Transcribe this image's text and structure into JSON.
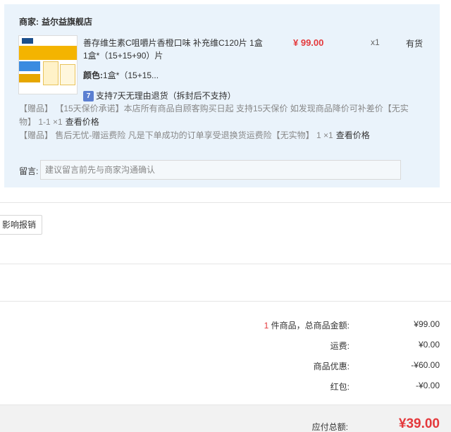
{
  "order": {
    "merchant_label": "商家:",
    "merchant_name": "益尔益旗舰店",
    "product": {
      "title": "善存维生素C咀嚼片香橙口味 补充维C120片 1盒 1盒*（15+15+90）片",
      "color_label": "颜色:",
      "color_value": "1盒*（15+15...",
      "price": "¥ 99.00",
      "quantity": "x1",
      "stock": "有货"
    },
    "return_policy": {
      "badge": "7",
      "text": "支持7天无理由退货（拆封后不支持）"
    },
    "gifts": [
      {
        "text": "【赠品】  【15天保价承诺】本店所有商品自顾客购买日起 支持15天保价 如发现商品降价可补差价【无实物】 1-1 ×1",
        "link": "查看价格"
      },
      {
        "text": "【赠品】  售后无忧-赠运费险 凡是下单成功的订单享受退换货运费险【无实物】 1 ×1",
        "link": "查看价格"
      }
    ],
    "message": {
      "label": "留言:",
      "placeholder": "建议留言前先与商家沟通确认"
    }
  },
  "reimburse_button": "影响报销",
  "summary": {
    "count": "1",
    "count_suffix": " 件商品，总商品金额:",
    "goods_total": "¥99.00",
    "shipping_label": "运费:",
    "shipping": "¥0.00",
    "discount_label": "商品优惠:",
    "discount": "-¥60.00",
    "redpacket_label": "红包:",
    "redpacket": "-¥0.00",
    "total_label": "应付总额:",
    "total": "¥39.00"
  },
  "colors": {
    "accent_red": "#e4393c",
    "panel_bg": "#eaf3fb",
    "badge_blue": "#5b7fd1"
  }
}
